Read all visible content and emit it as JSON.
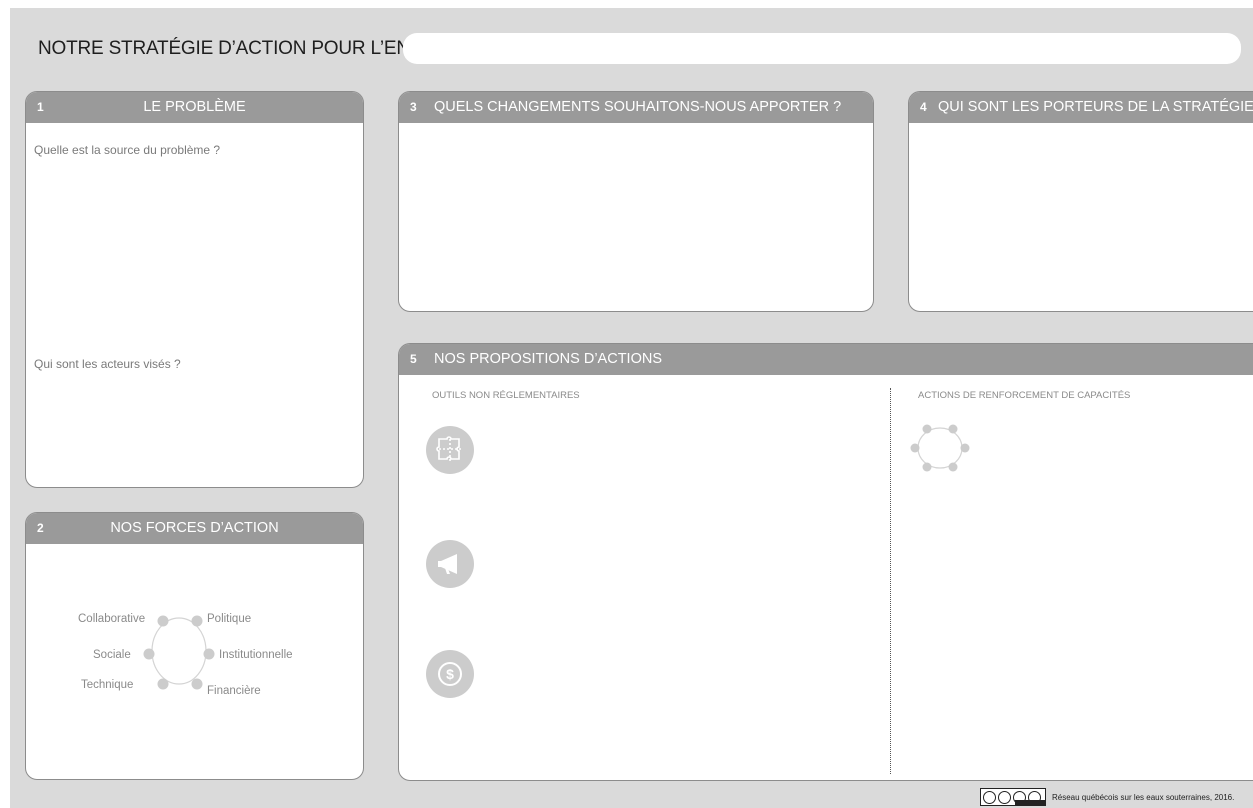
{
  "header": {
    "title": "NOTRE STRATÉGIE D’ACTION POUR L’ENJEU :",
    "issue_value": ""
  },
  "panels": {
    "problem": {
      "number": "1",
      "title": "LE PROBLÈME",
      "question_source": "Quelle est la source du problème ?",
      "question_actors": "Qui sont les acteurs visés ?"
    },
    "forces": {
      "number": "2",
      "title": "NOS FORCES D’ACTION",
      "labels": {
        "collaborative": "Collaborative",
        "politique": "Politique",
        "sociale": "Sociale",
        "institutionnelle": "Institutionnelle",
        "technique": "Technique",
        "financiere": "Financière"
      }
    },
    "changes": {
      "number": "3",
      "title": "QUELS CHANGEMENTS SOUHAITONS-NOUS APPORTER ?"
    },
    "carriers": {
      "number": "4",
      "title": "QUI SONT LES PORTEURS DE LA STRATÉGIE ?"
    },
    "proposals": {
      "number": "5",
      "title": "NOS PROPOSITIONS D’ACTIONS",
      "left_heading": "OUTILS NON RÉGLEMENTAIRES",
      "right_heading": "ACTIONS DE RENFORCEMENT DE CAPACITÉS",
      "icons": [
        "puzzle-icon",
        "megaphone-icon",
        "dollar-icon",
        "capacity-cycle-icon"
      ]
    }
  },
  "footer": {
    "license_icon": "cc-by-nc-sa-icon",
    "credit": "Réseau québécois sur les eaux souterraines, 2016."
  },
  "colors": {
    "background": "#dadada",
    "header_bar": "#9a9a9a",
    "panel_border": "#8c8c8c",
    "text_muted": "#7a7a7a"
  }
}
